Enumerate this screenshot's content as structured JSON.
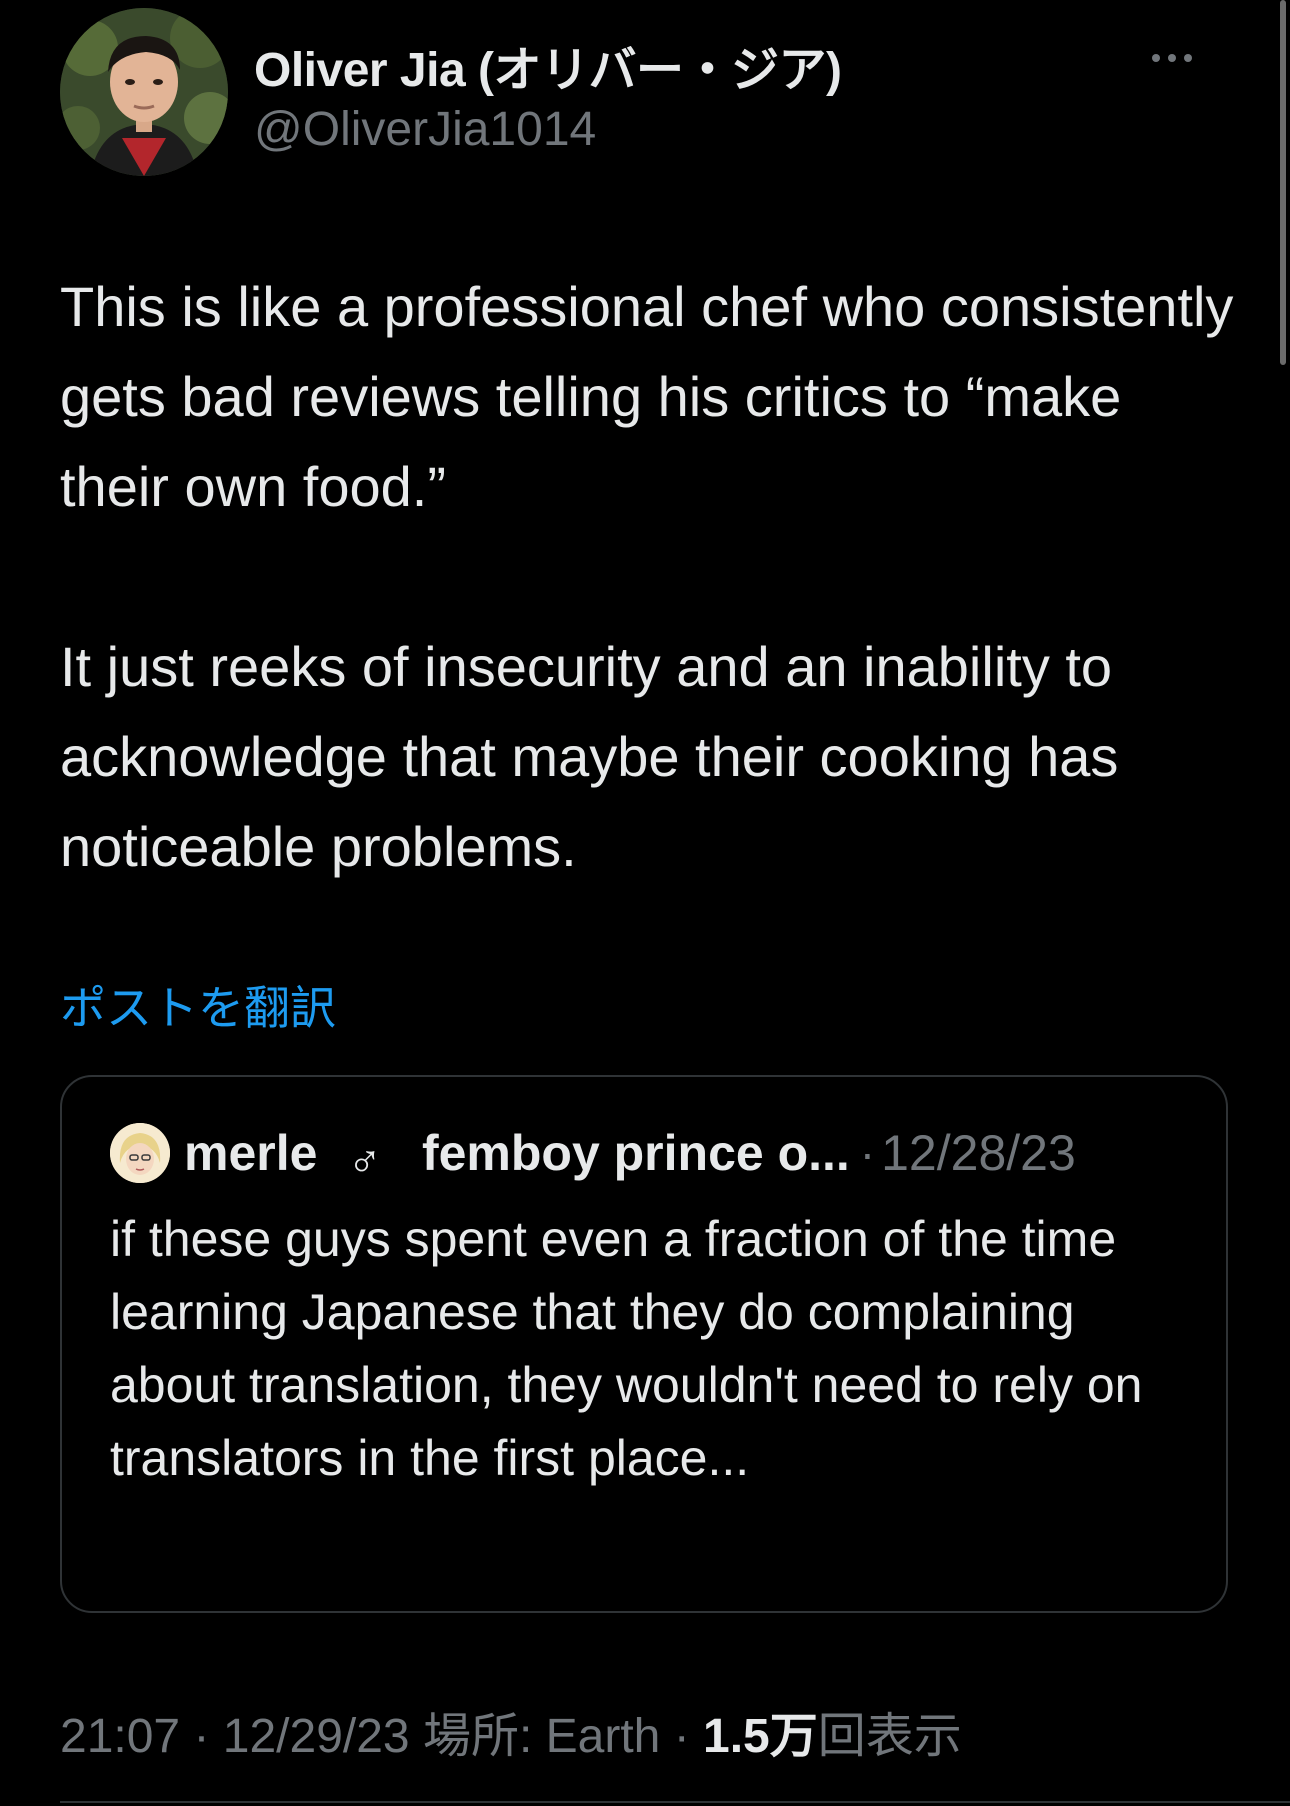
{
  "author": {
    "name": "Oliver Jia (オリバー・ジア)",
    "handle": "@OliverJia1014",
    "avatar_icon": "profile-photo"
  },
  "more_icon": "more-horizontal-icon",
  "tweet": {
    "paragraph_1": "This is like a professional chef who consistently gets bad reviews telling his critics to “make their own food.”",
    "paragraph_2": "It just reeks of insecurity and an inability to acknowledge that maybe their cooking has noticeable problems.",
    "translate_label": "ポストを翻訳"
  },
  "quoted": {
    "name": "merle",
    "gender_symbol": "♂",
    "display": "femboy prince o...",
    "separator": "·",
    "date": "12/28/23",
    "text": "if these guys spent even a fraction of the time learning Japanese that they do complaining about translation, they wouldn't need to rely on translators in the first place..."
  },
  "meta": {
    "time_date": "21:07 · 12/29/23 場所: Earth · ",
    "views_count": "1.5万",
    "views_label": "回表示"
  },
  "colors": {
    "background": "#000000",
    "text": "#e7e9ea",
    "muted": "#71767b",
    "link": "#1d9bf0",
    "border": "#2f3336"
  }
}
